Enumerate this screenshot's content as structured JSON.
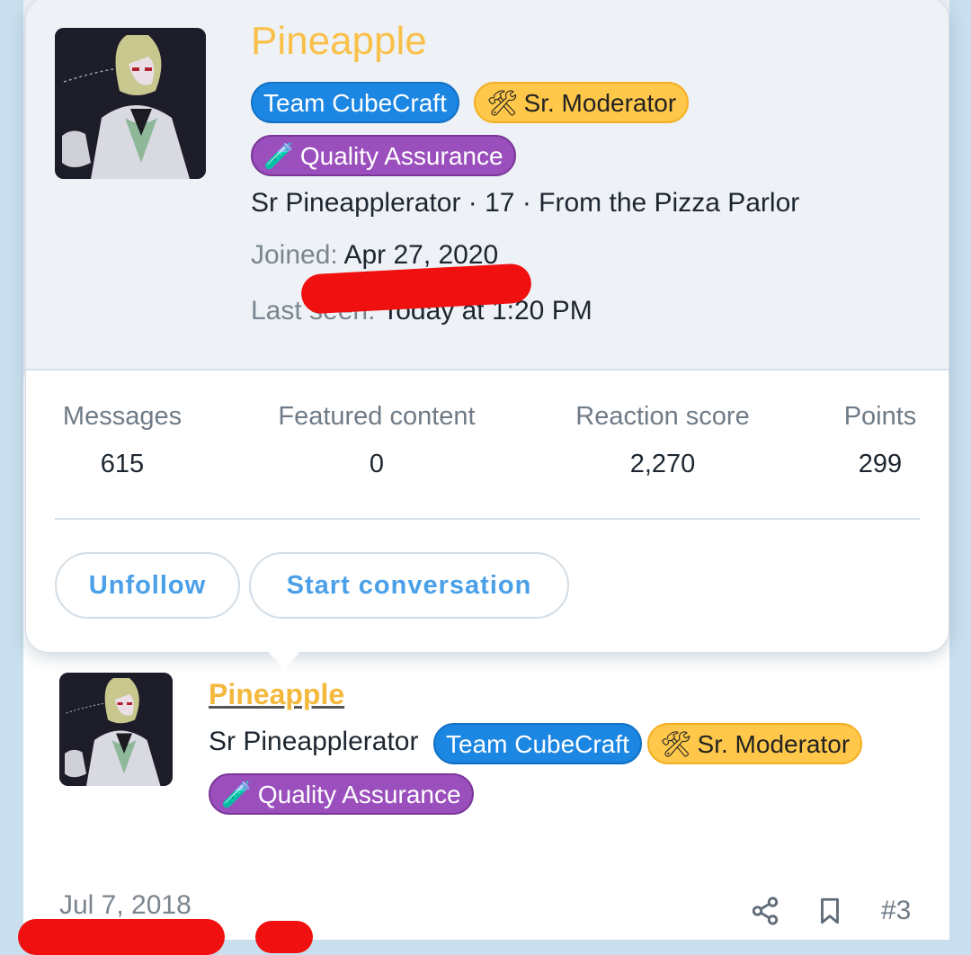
{
  "card": {
    "username": "Pineapple",
    "badges": [
      {
        "label": "Team CubeCraft",
        "icon": ""
      },
      {
        "label": "Sr. Moderator",
        "icon": "🛠"
      },
      {
        "label": "Quality Assurance",
        "icon": "🧪"
      }
    ],
    "user_title": "Sr Pineapplerator",
    "age": "17",
    "location": "From the Pizza Parlor",
    "tagline": "Sr Pineapplerator · 17 · From the Pizza Parlor",
    "joined_label": "Joined:",
    "joined_value": "Apr 27, 2020",
    "last_seen_label": "Last seen:",
    "last_seen_value": "Today at 1:20 PM",
    "stats": [
      {
        "label": "Messages",
        "value": "615"
      },
      {
        "label": "Featured content",
        "value": "0"
      },
      {
        "label": "Reaction score",
        "value": "2,270"
      },
      {
        "label": "Points",
        "value": "299"
      }
    ],
    "buttons": {
      "unfollow": "Unfollow",
      "start_conversation": "Start conversation"
    }
  },
  "post": {
    "username": "Pineapple",
    "user_title": "Sr Pineapplerator",
    "badges": [
      {
        "label": "Team CubeCraft",
        "icon": ""
      },
      {
        "label": "Sr. Moderator",
        "icon": "🛠"
      },
      {
        "label": "Quality Assurance",
        "icon": "🧪"
      }
    ],
    "date": "Jul 7, 2018",
    "post_number": "#3"
  },
  "icons": {
    "share": "share-icon",
    "bookmark": "bookmark-icon"
  },
  "colors": {
    "username": "#f9c04a",
    "team_badge": "#1c86e3",
    "moderator_badge": "#ffc84a",
    "qa_badge": "#9b4fbd",
    "button_text": "#4aa0e8",
    "redaction": "#f01010"
  }
}
